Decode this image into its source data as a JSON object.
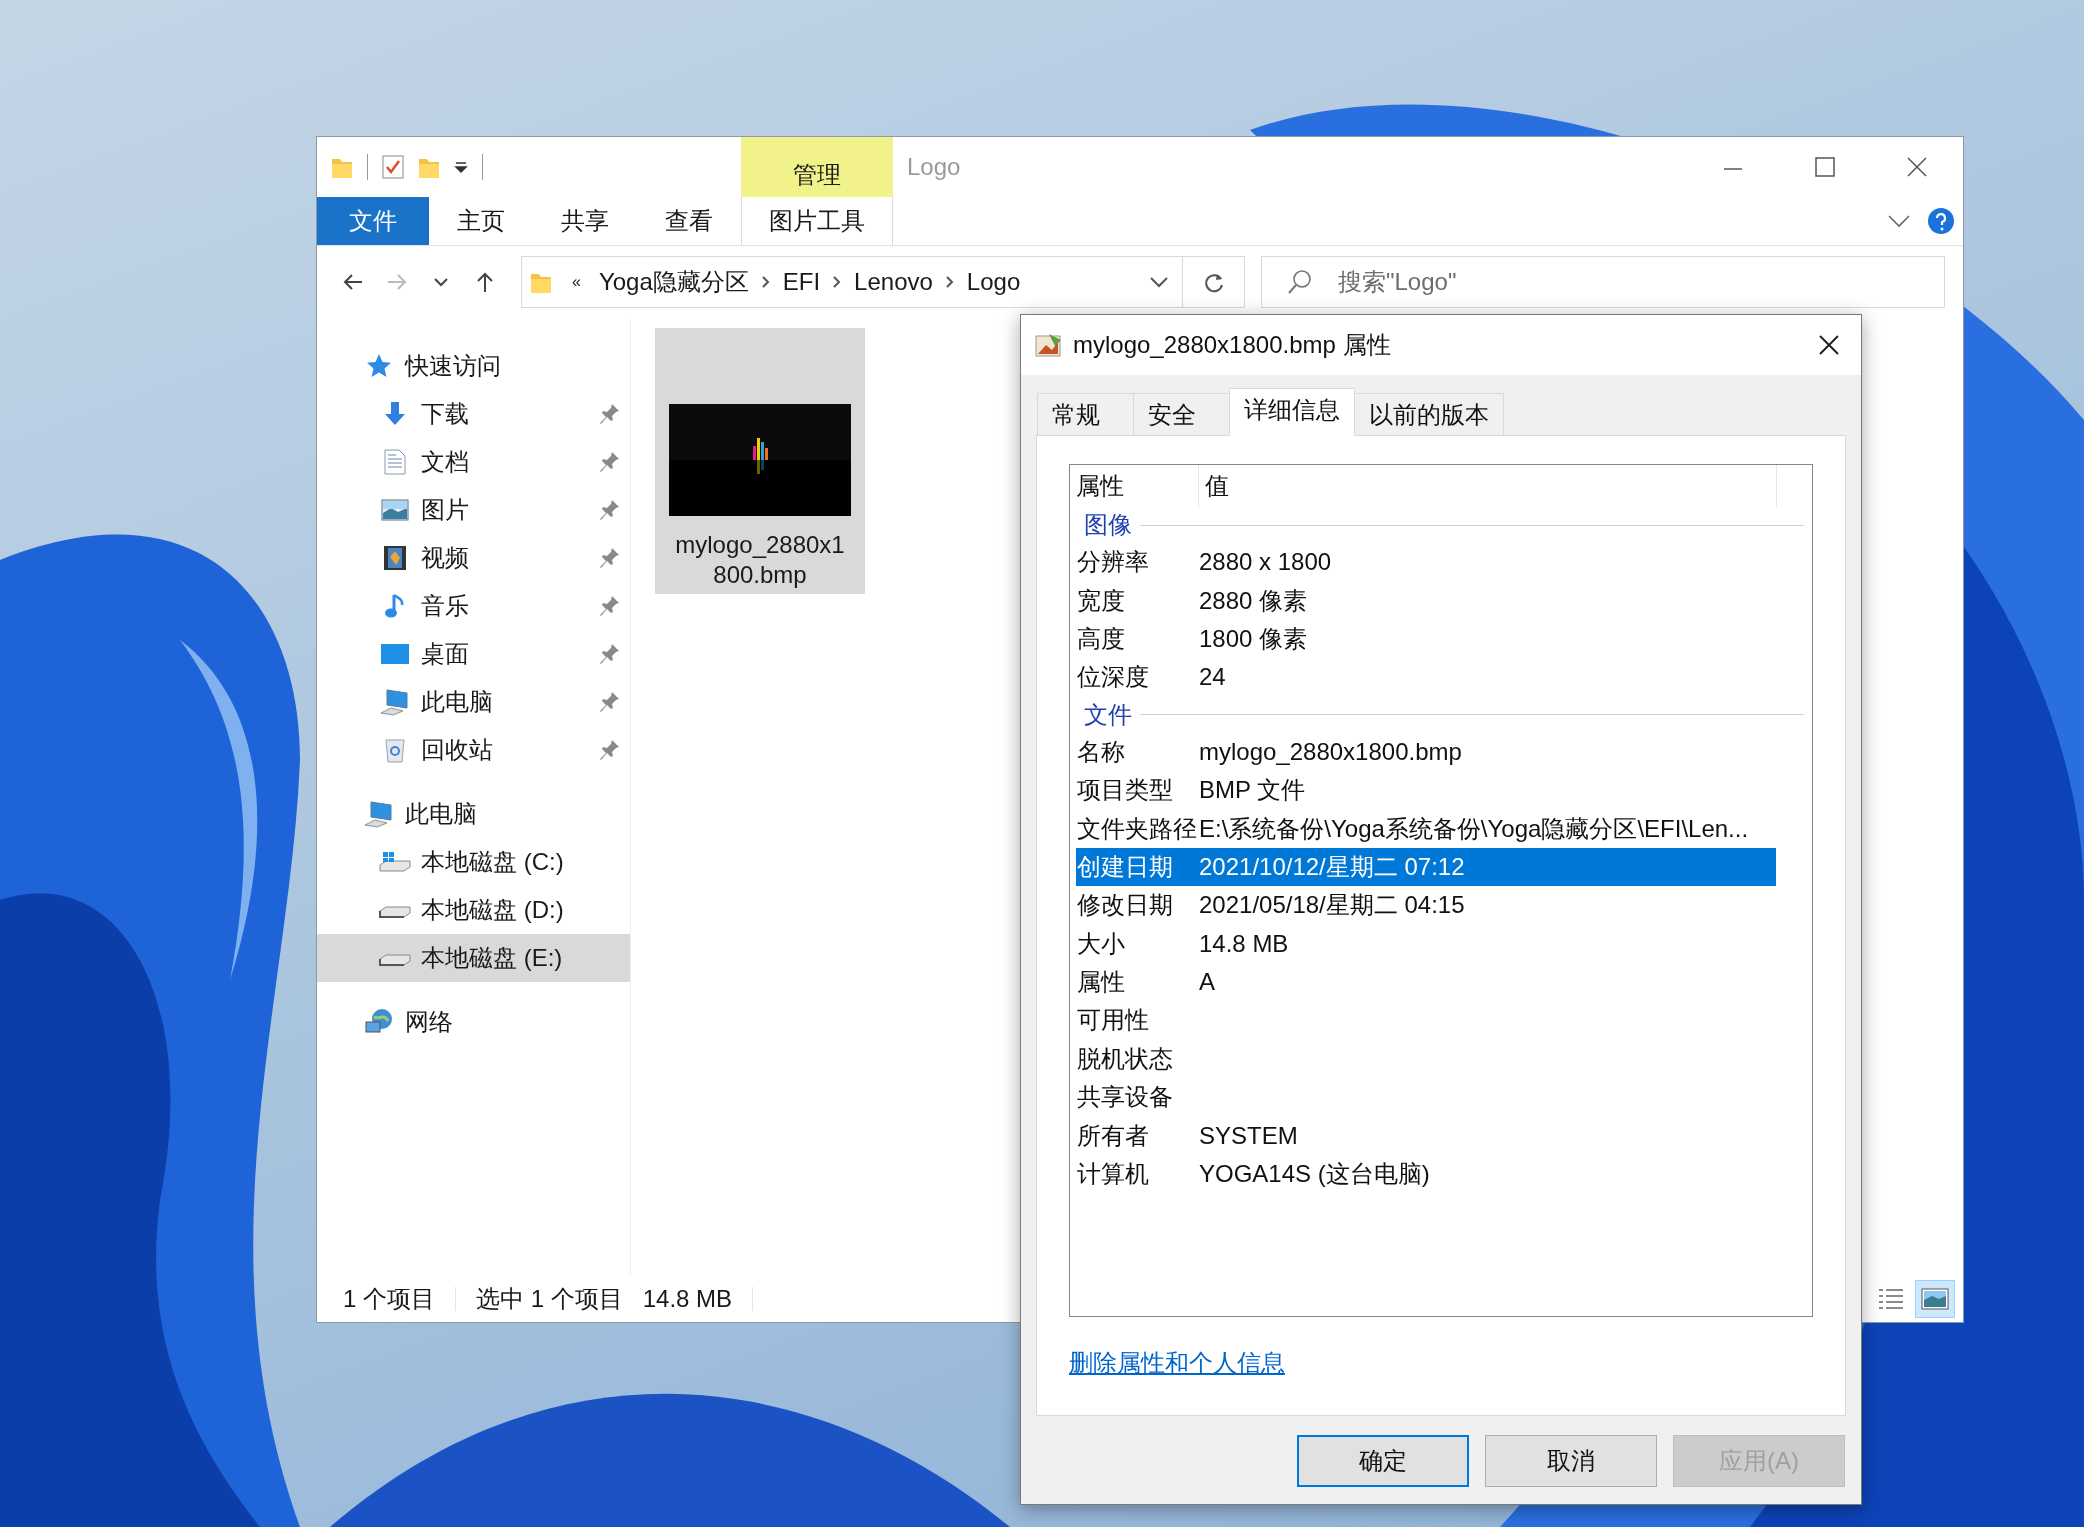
{
  "explorer": {
    "contextual_group": "管理",
    "title": "Logo",
    "ribbon_tabs": [
      {
        "label": "文件",
        "kind": "file"
      },
      {
        "label": "主页",
        "kind": "tab"
      },
      {
        "label": "共享",
        "kind": "tab"
      },
      {
        "label": "查看",
        "kind": "tab"
      },
      {
        "label": "图片工具",
        "kind": "contextual"
      }
    ],
    "address": {
      "overflow_marker": "«",
      "breadcrumbs": [
        "Yoga隐藏分区",
        "EFI",
        "Lenovo",
        "Logo"
      ]
    },
    "search": {
      "placeholder": "搜索\"Logo\""
    },
    "navigation": [
      {
        "label": "快速访问",
        "kind": "quick-access",
        "pinned": false,
        "selected": false,
        "children": [
          {
            "label": "下载",
            "kind": "downloads",
            "pinned": true,
            "selected": false
          },
          {
            "label": "文档",
            "kind": "documents",
            "pinned": true,
            "selected": false
          },
          {
            "label": "图片",
            "kind": "pictures",
            "pinned": true,
            "selected": false
          },
          {
            "label": "视频",
            "kind": "videos",
            "pinned": true,
            "selected": false
          },
          {
            "label": "音乐",
            "kind": "music",
            "pinned": true,
            "selected": false
          },
          {
            "label": "桌面",
            "kind": "desktop",
            "pinned": true,
            "selected": false
          },
          {
            "label": "此电脑",
            "kind": "computer",
            "pinned": true,
            "selected": false
          },
          {
            "label": "回收站",
            "kind": "recycle-bin",
            "pinned": true,
            "selected": false
          }
        ]
      },
      {
        "label": "此电脑",
        "kind": "computer",
        "pinned": false,
        "selected": false,
        "children": [
          {
            "label": "本地磁盘 (C:)",
            "kind": "system-drive",
            "pinned": false,
            "selected": false
          },
          {
            "label": "本地磁盘 (D:)",
            "kind": "drive",
            "pinned": false,
            "selected": false
          },
          {
            "label": "本地磁盘 (E:)",
            "kind": "drive",
            "pinned": false,
            "selected": true
          }
        ]
      },
      {
        "label": "网络",
        "kind": "network",
        "pinned": false,
        "selected": false
      }
    ],
    "files": [
      {
        "name": "mylogo_2880x1800.bmp",
        "selected": true
      }
    ],
    "status_bar": {
      "item_count": "1 个项目",
      "selection": "选中 1 个项目",
      "selection_size": "14.8 MB"
    },
    "view_modes": [
      {
        "kind": "details",
        "selected": false
      },
      {
        "kind": "large-icons",
        "selected": true
      }
    ]
  },
  "dialog": {
    "title": "mylogo_2880x1800.bmp 属性",
    "tabs": [
      {
        "label": "常规",
        "selected": false
      },
      {
        "label": "安全",
        "selected": false
      },
      {
        "label": "详细信息",
        "selected": true
      },
      {
        "label": "以前的版本",
        "selected": false
      }
    ],
    "columns": [
      "属性",
      "值"
    ],
    "groups": [
      {
        "label": "图像",
        "rows": [
          {
            "property": "分辨率",
            "value": "2880 x 1800",
            "selected": false
          },
          {
            "property": "宽度",
            "value": "2880 像素",
            "selected": false
          },
          {
            "property": "高度",
            "value": "1800 像素",
            "selected": false
          },
          {
            "property": "位深度",
            "value": "24",
            "selected": false
          }
        ]
      },
      {
        "label": "文件",
        "rows": [
          {
            "property": "名称",
            "value": "mylogo_2880x1800.bmp",
            "selected": false
          },
          {
            "property": "项目类型",
            "value": "BMP 文件",
            "selected": false
          },
          {
            "property": "文件夹路径",
            "value": "E:\\系统备份\\Yoga系统备份\\Yoga隐藏分区\\EFI\\Len...",
            "selected": false
          },
          {
            "property": "创建日期",
            "value": "2021/10/12/星期二 07:12",
            "selected": true
          },
          {
            "property": "修改日期",
            "value": "2021/05/18/星期二 04:15",
            "selected": false
          },
          {
            "property": "大小",
            "value": "14.8 MB",
            "selected": false
          },
          {
            "property": "属性",
            "value": "A",
            "selected": false
          },
          {
            "property": "可用性",
            "selected": false
          },
          {
            "property": "脱机状态",
            "selected": false
          },
          {
            "property": "共享设备",
            "selected": false
          },
          {
            "property": "所有者",
            "value": "SYSTEM",
            "selected": false
          },
          {
            "property": "计算机",
            "value": "YOGA14S (这台电脑)",
            "selected": false
          }
        ]
      }
    ],
    "link": "删除属性和个人信息",
    "buttons": [
      {
        "label": "确定",
        "kind": "default",
        "disabled": false
      },
      {
        "label": "取消",
        "kind": "normal",
        "disabled": false
      },
      {
        "label": "应用(A)",
        "kind": "normal",
        "disabled": true
      }
    ]
  }
}
